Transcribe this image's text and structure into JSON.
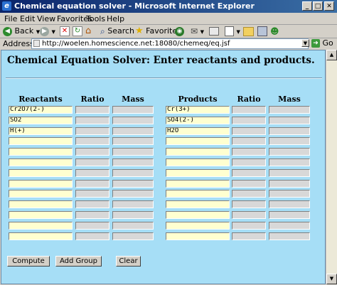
{
  "window": {
    "title": "Chemical equation solver - Microsoft Internet Explorer"
  },
  "menu": [
    "File",
    "Edit",
    "View",
    "Favorites",
    "Tools",
    "Help"
  ],
  "toolbar": {
    "back_label": "Back",
    "search_label": "Search",
    "favorites_label": "Favorites"
  },
  "address": {
    "label": "Address",
    "url": "http://woelen.homescience.net:18080/chemeq/eq.jsf",
    "go_label": "Go"
  },
  "page": {
    "heading": "Chemical Equation Solver: Enter reactants and products.",
    "reactants_header": "Reactants",
    "products_header": "Products",
    "ratio_header": "Ratio",
    "mass_header": "Mass",
    "reactants": [
      "Cr2O7(2-)",
      "SO2",
      "H(+)",
      "",
      "",
      "",
      "",
      "",
      "",
      "",
      "",
      "",
      ""
    ],
    "products": [
      "Cr(3+)",
      "SO4(2-)",
      "H2O",
      "",
      "",
      "",
      "",
      "",
      "",
      "",
      "",
      "",
      ""
    ]
  },
  "buttons": {
    "compute": "Compute",
    "add_group": "Add Group",
    "clear": "Clear"
  }
}
